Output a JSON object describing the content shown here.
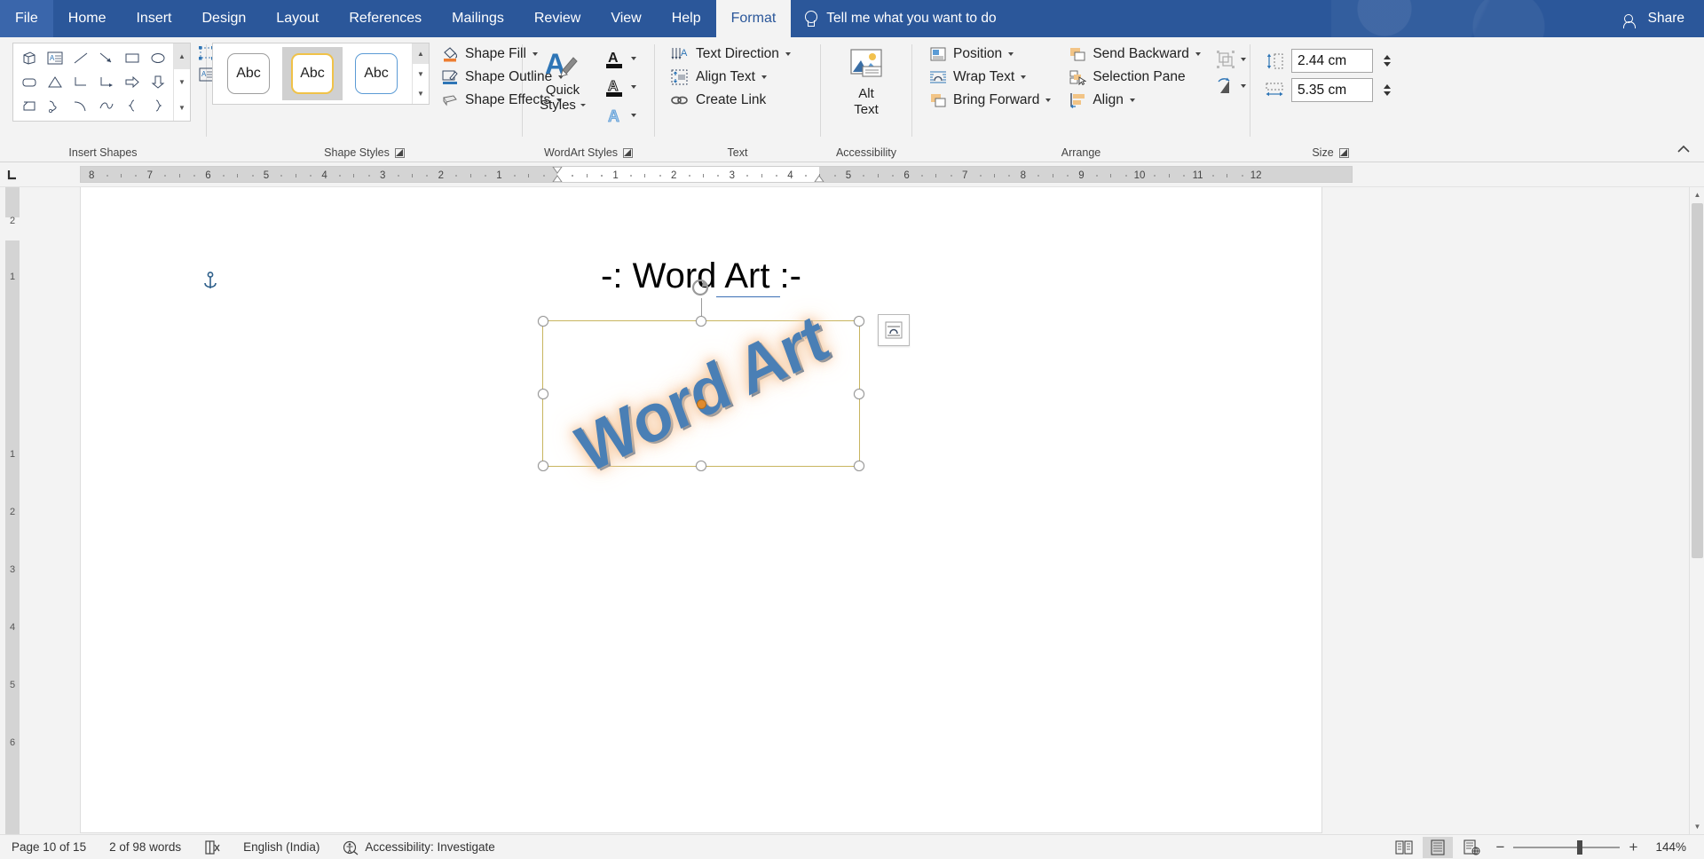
{
  "titlebar": {
    "tabs": [
      {
        "label": "File",
        "active": false
      },
      {
        "label": "Home",
        "active": false
      },
      {
        "label": "Insert",
        "active": false
      },
      {
        "label": "Design",
        "active": false
      },
      {
        "label": "Layout",
        "active": false
      },
      {
        "label": "References",
        "active": false
      },
      {
        "label": "Mailings",
        "active": false
      },
      {
        "label": "Review",
        "active": false
      },
      {
        "label": "View",
        "active": false
      },
      {
        "label": "Help",
        "active": false
      },
      {
        "label": "Format",
        "active": true
      }
    ],
    "tellme": "Tell me what you want to do",
    "tellme_icon": "lightbulb-icon",
    "share": "Share",
    "share_icon": "share-person-icon",
    "accent": "#2b579a"
  },
  "ribbon": {
    "groups": {
      "insert_shapes": {
        "label": "Insert Shapes",
        "shapes": [
          "cube-shape",
          "text-box-shape",
          "line-shape",
          "line-arrow-shape",
          "rectangle-shape",
          "oval-shape",
          "rounded-rectangle-shape",
          "triangle-shape",
          "elbow-connector-shape",
          "elbow-arrow-connector-shape",
          "right-arrow-shape",
          "down-arrow-shape",
          "folded-corner-shape",
          "scribble-shape",
          "curve-shape",
          "freeform-shape",
          "left-brace-shape",
          "right-brace-shape"
        ],
        "edit_shape_label": "",
        "edit_shape_icon": "edit-shape-icon",
        "text_box_icon": "draw-text-box-icon"
      },
      "shape_styles": {
        "label": "Shape Styles",
        "thumbs": [
          {
            "text": "Abc",
            "border": "#9e9e9e",
            "selected": false
          },
          {
            "text": "Abc",
            "border": "#f0c248",
            "selected": true
          },
          {
            "text": "Abc",
            "border": "#5b9bd5",
            "selected": false
          }
        ],
        "shape_fill": "Shape Fill",
        "shape_fill_icon": "paint-bucket-icon",
        "shape_fill_color": "#ed7d31",
        "shape_outline": "Shape Outline",
        "shape_outline_icon": "pencil-outline-icon",
        "shape_outline_color": "#2e75b6",
        "shape_effects": "Shape Effects",
        "shape_effects_icon": "shape-effects-icon"
      },
      "wordart_styles": {
        "label": "WordArt Styles",
        "quick_styles": "Quick\nStyles",
        "quick_styles_line1": "Quick",
        "quick_styles_line2": "Styles",
        "quick_styles_icon": "wordart-quick-styles-icon",
        "text_fill_icon": "text-fill-a-icon",
        "text_outline_icon": "text-outline-a-icon",
        "text_effects_icon": "text-effects-a-icon"
      },
      "text": {
        "label": "Text",
        "text_direction": "Text Direction",
        "text_direction_icon": "text-direction-icon",
        "align_text": "Align Text",
        "align_text_icon": "align-text-icon",
        "create_link": "Create Link",
        "create_link_icon": "chain-link-icon"
      },
      "accessibility": {
        "label": "Accessibility",
        "alt_text_line1": "Alt",
        "alt_text_line2": "Text",
        "alt_text_icon": "alt-text-picture-icon"
      },
      "arrange": {
        "label": "Arrange",
        "position": "Position",
        "position_icon": "position-icon",
        "wrap_text": "Wrap Text",
        "wrap_text_icon": "wrap-text-icon",
        "bring_forward": "Bring Forward",
        "bring_forward_icon": "bring-forward-icon",
        "send_backward": "Send Backward",
        "send_backward_icon": "send-backward-icon",
        "selection_pane": "Selection Pane",
        "selection_pane_icon": "selection-pane-icon",
        "align": "Align",
        "align_icon": "align-objects-icon",
        "group_icon": "group-objects-icon",
        "rotate_icon": "rotate-objects-icon"
      },
      "size": {
        "label": "Size",
        "height_value": "2.44 cm",
        "height_icon": "shape-height-icon",
        "width_value": "5.35 cm",
        "width_icon": "shape-width-icon"
      }
    },
    "collapse_icon": "collapse-ribbon-chevron-icon"
  },
  "ruler": {
    "tab_stop_icon": "left-tab-stop-icon",
    "left_labels": [
      "8",
      "7",
      "6",
      "5",
      "4",
      "3",
      "2",
      "1"
    ],
    "right_labels": [
      "1",
      "2",
      "3",
      "4",
      "5",
      "6",
      "7",
      "8",
      "9",
      "10",
      "11",
      "12"
    ],
    "vertical_labels": [
      "2",
      "1",
      "1",
      "2",
      "3",
      "4",
      "5",
      "6"
    ]
  },
  "document": {
    "heading_prefix": "-: Word",
    "heading_underlined": " Art ",
    "heading_suffix": ":-",
    "heading_full": "-: Word Art :-",
    "anchor_icon": "object-anchor-icon",
    "wordart_text": "Word Art",
    "wordart_color": "#4a7fb5",
    "wordart_glow": "#f6c9a0",
    "selection_border_color": "#c8b560",
    "rotate_handle_icon": "rotation-handle-icon",
    "adjust_handle_name": "adjustment-handle",
    "layout_options_icon": "layout-options-icon"
  },
  "status": {
    "page": "Page 10 of 15",
    "words": "2 of 98 words",
    "proofing_icon": "proofing-errors-icon",
    "language": "English (India)",
    "accessibility": "Accessibility: Investigate",
    "accessibility_icon": "accessibility-icon",
    "views": [
      {
        "name": "read-mode",
        "icon": "read-mode-icon",
        "active": false
      },
      {
        "name": "print-layout",
        "icon": "print-layout-icon",
        "active": true
      },
      {
        "name": "web-layout",
        "icon": "web-layout-icon",
        "active": false
      }
    ],
    "zoom_out_icon": "zoom-out-icon",
    "zoom_in_icon": "zoom-in-icon",
    "zoom_value": "144%"
  }
}
